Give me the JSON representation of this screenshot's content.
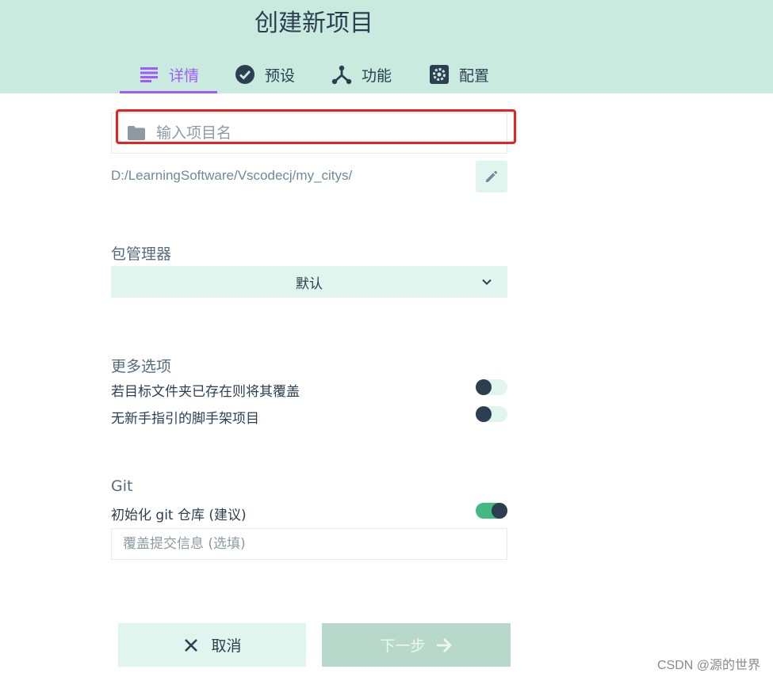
{
  "header": {
    "title": "创建新项目",
    "tabs": [
      {
        "label": "详情",
        "icon": "list-icon",
        "active": true
      },
      {
        "label": "预设",
        "icon": "check-circle-icon",
        "active": false
      },
      {
        "label": "功能",
        "icon": "features-icon",
        "active": false
      },
      {
        "label": "配置",
        "icon": "gear-icon",
        "active": false
      }
    ]
  },
  "details": {
    "name_placeholder": "输入项目名",
    "name_value": "",
    "path": "D:/LearningSoftware/Vscodecj/my_citys/",
    "package_manager_label": "包管理器",
    "package_manager_value": "默认",
    "more_options_label": "更多选项",
    "options": [
      {
        "label": "若目标文件夹已存在则将其覆盖",
        "enabled": false
      },
      {
        "label": "无新手指引的脚手架项目",
        "enabled": false
      }
    ],
    "git_label": "Git",
    "git_init_label": "初始化 git 仓库 (建议)",
    "git_init_enabled": true,
    "commit_placeholder": "覆盖提交信息 (选填)",
    "commit_value": ""
  },
  "footer": {
    "cancel_label": "取消",
    "next_label": "下一步"
  },
  "watermark": "CSDN @源的世界",
  "colors": {
    "header_bg": "#c8eadf",
    "accent_purple": "#a259ff",
    "accent_green": "#42b983",
    "text_dark": "#2c3e50",
    "highlight_red": "#e8231f"
  }
}
